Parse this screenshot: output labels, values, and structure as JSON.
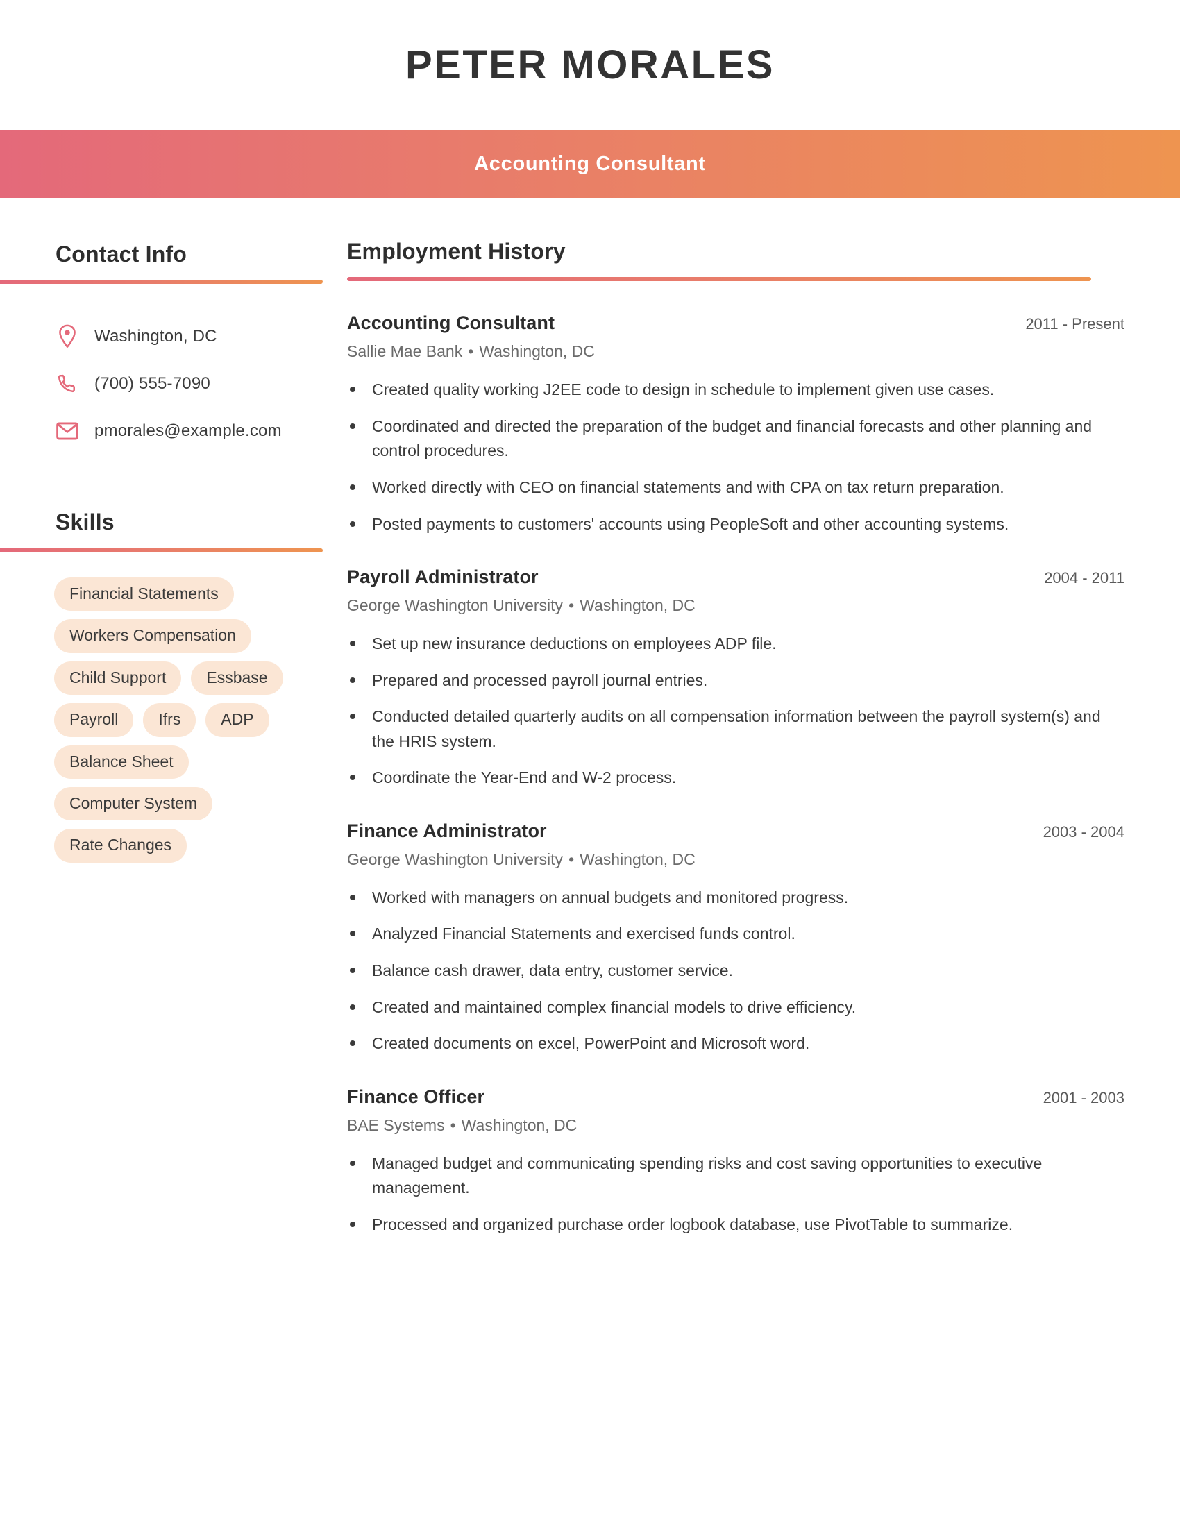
{
  "header": {
    "name": "PETER MORALES",
    "role": "Accounting Consultant",
    "gradient_start": "#e4697a",
    "gradient_end": "#ee9450"
  },
  "sidebar": {
    "contact": {
      "heading": "Contact Info",
      "items": [
        {
          "icon": "location-pin-icon",
          "text": "Washington, DC"
        },
        {
          "icon": "phone-icon",
          "text": "(700) 555-7090"
        },
        {
          "icon": "envelope-icon",
          "text": "pmorales@example.com"
        }
      ]
    },
    "skills": {
      "heading": "Skills",
      "pill_color": "#fbe6d5",
      "items": [
        "Financial Statements",
        "Workers Compensation",
        "Child Support",
        "Essbase",
        "Payroll",
        "Ifrs",
        "ADP",
        "Balance Sheet",
        "Computer System",
        "Rate Changes"
      ]
    }
  },
  "main": {
    "heading": "Employment History",
    "jobs": [
      {
        "title": "Accounting Consultant",
        "dates": "2011 - Present",
        "company": "Sallie Mae Bank",
        "location": "Washington, DC",
        "bullets": [
          "Created quality working J2EE code to design in schedule to implement given use cases.",
          "Coordinated and directed the preparation of the budget and financial forecasts and other planning and control procedures.",
          "Worked directly with CEO on financial statements and with CPA on tax return preparation.",
          "Posted payments to customers' accounts using PeopleSoft and other accounting systems."
        ]
      },
      {
        "title": "Payroll Administrator",
        "dates": "2004 - 2011",
        "company": "George Washington University",
        "location": "Washington, DC",
        "bullets": [
          "Set up new insurance deductions on employees ADP file.",
          "Prepared and processed payroll journal entries.",
          "Conducted detailed quarterly audits on all compensation information between the payroll system(s) and the HRIS system.",
          "Coordinate the Year-End and W-2 process."
        ]
      },
      {
        "title": "Finance Administrator",
        "dates": "2003 - 2004",
        "company": "George Washington University",
        "location": "Washington, DC",
        "bullets": [
          "Worked with managers on annual budgets and monitored progress.",
          "Analyzed Financial Statements and exercised funds control.",
          "Balance cash drawer, data entry, customer service.",
          "Created and maintained complex financial models to drive efficiency.",
          "Created documents on excel, PowerPoint and Microsoft word."
        ]
      },
      {
        "title": "Finance Officer",
        "dates": "2001 - 2003",
        "company": "BAE Systems",
        "location": "Washington, DC",
        "bullets": [
          "Managed budget and communicating spending risks and cost saving opportunities to executive management.",
          "Processed and organized purchase order logbook database, use PivotTable to summarize."
        ]
      }
    ]
  },
  "separator": "•"
}
